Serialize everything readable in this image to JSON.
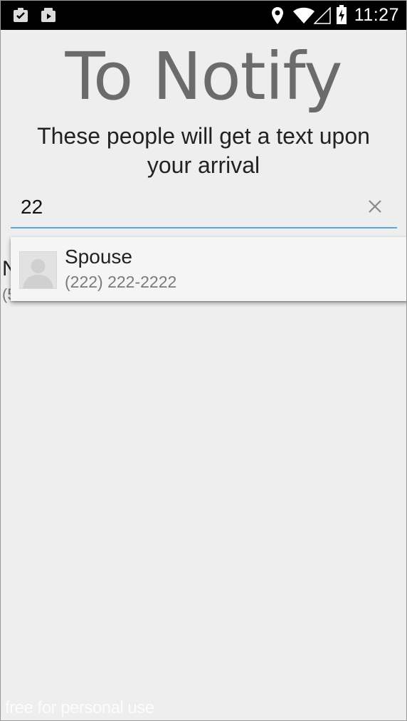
{
  "status_bar": {
    "time": "11:27",
    "icons": [
      "clipboard-check-icon",
      "media-play-icon",
      "location-pin-icon",
      "wifi-icon",
      "signal-icon",
      "battery-charging-icon"
    ]
  },
  "page": {
    "title": "To Notify",
    "subtitle": "These people will get a text upon your arrival"
  },
  "search": {
    "value": "22"
  },
  "background_contact": {
    "name_partial": "N",
    "number_partial": "(5"
  },
  "suggestion": {
    "name": "Spouse",
    "number": "(222) 222-2222"
  },
  "watermark": "free for personal use",
  "colors": {
    "background": "#eeeeee",
    "accent_underline": "#59a9d6",
    "title_gray": "#6b6b6b"
  }
}
